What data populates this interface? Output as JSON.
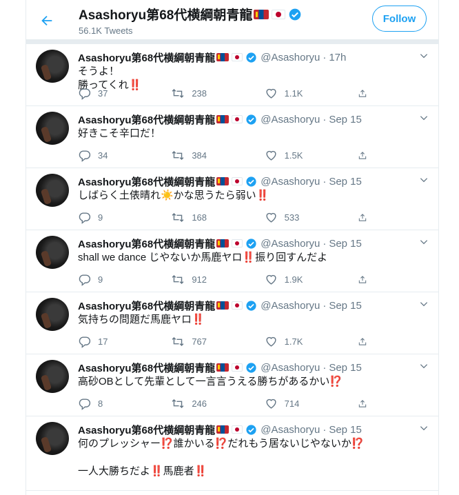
{
  "header": {
    "name": "Asashoryu第68代横綱朝青龍",
    "tweets_count": "56.1K Tweets",
    "follow_label": "Follow"
  },
  "colors": {
    "accent": "#1da1f2",
    "muted": "#657786",
    "border": "#e6ecf0"
  },
  "icons": [
    "back-arrow-icon",
    "mongolia-flag-icon",
    "japan-flag-icon",
    "verified-icon",
    "caret-down-icon",
    "reply-icon",
    "retweet-icon",
    "like-icon",
    "share-icon"
  ],
  "tweets": [
    {
      "name": "Asashoryu第68代横綱朝青龍",
      "handle": "@Asashoryu",
      "dot": "·",
      "time": "17h",
      "text": "そうよ！\n勝ってくれ‼️",
      "replies": "37",
      "retweets": "238",
      "likes": "1.1K"
    },
    {
      "name": "Asashoryu第68代横綱朝青龍",
      "handle": "@Asashoryu",
      "dot": "·",
      "time": "Sep 15",
      "text": "好きこそ辛口だ！",
      "replies": "34",
      "retweets": "384",
      "likes": "1.5K"
    },
    {
      "name": "Asashoryu第68代横綱朝青龍",
      "handle": "@Asashoryu",
      "dot": "·",
      "time": "Sep 15",
      "text": "しばらく土俵晴れ☀️かな思うたら弱い‼️",
      "replies": "9",
      "retweets": "168",
      "likes": "533"
    },
    {
      "name": "Asashoryu第68代横綱朝青龍",
      "handle": "@Asashoryu",
      "dot": "·",
      "time": "Sep 15",
      "text": "shall we dance じやないか馬鹿ヤロ‼️振り回すんだよ",
      "replies": "9",
      "retweets": "912",
      "likes": "1.9K"
    },
    {
      "name": "Asashoryu第68代横綱朝青龍",
      "handle": "@Asashoryu",
      "dot": "·",
      "time": "Sep 15",
      "text": "気持ちの問題だ馬鹿ヤロ‼️",
      "replies": "17",
      "retweets": "767",
      "likes": "1.7K"
    },
    {
      "name": "Asashoryu第68代横綱朝青龍",
      "handle": "@Asashoryu",
      "dot": "·",
      "time": "Sep 15",
      "text": "高砂OBとして先輩として一言言うえる勝ちがあるかい⁉️",
      "replies": "8",
      "retweets": "246",
      "likes": "714"
    },
    {
      "name": "Asashoryu第68代横綱朝青龍",
      "handle": "@Asashoryu",
      "dot": "·",
      "time": "Sep 15",
      "text": "何のプレッシャー⁉️誰かいる⁉️だれもう居ないじやないか⁉️\n\n一人大勝ちだよ‼️馬鹿者‼️"
    }
  ]
}
